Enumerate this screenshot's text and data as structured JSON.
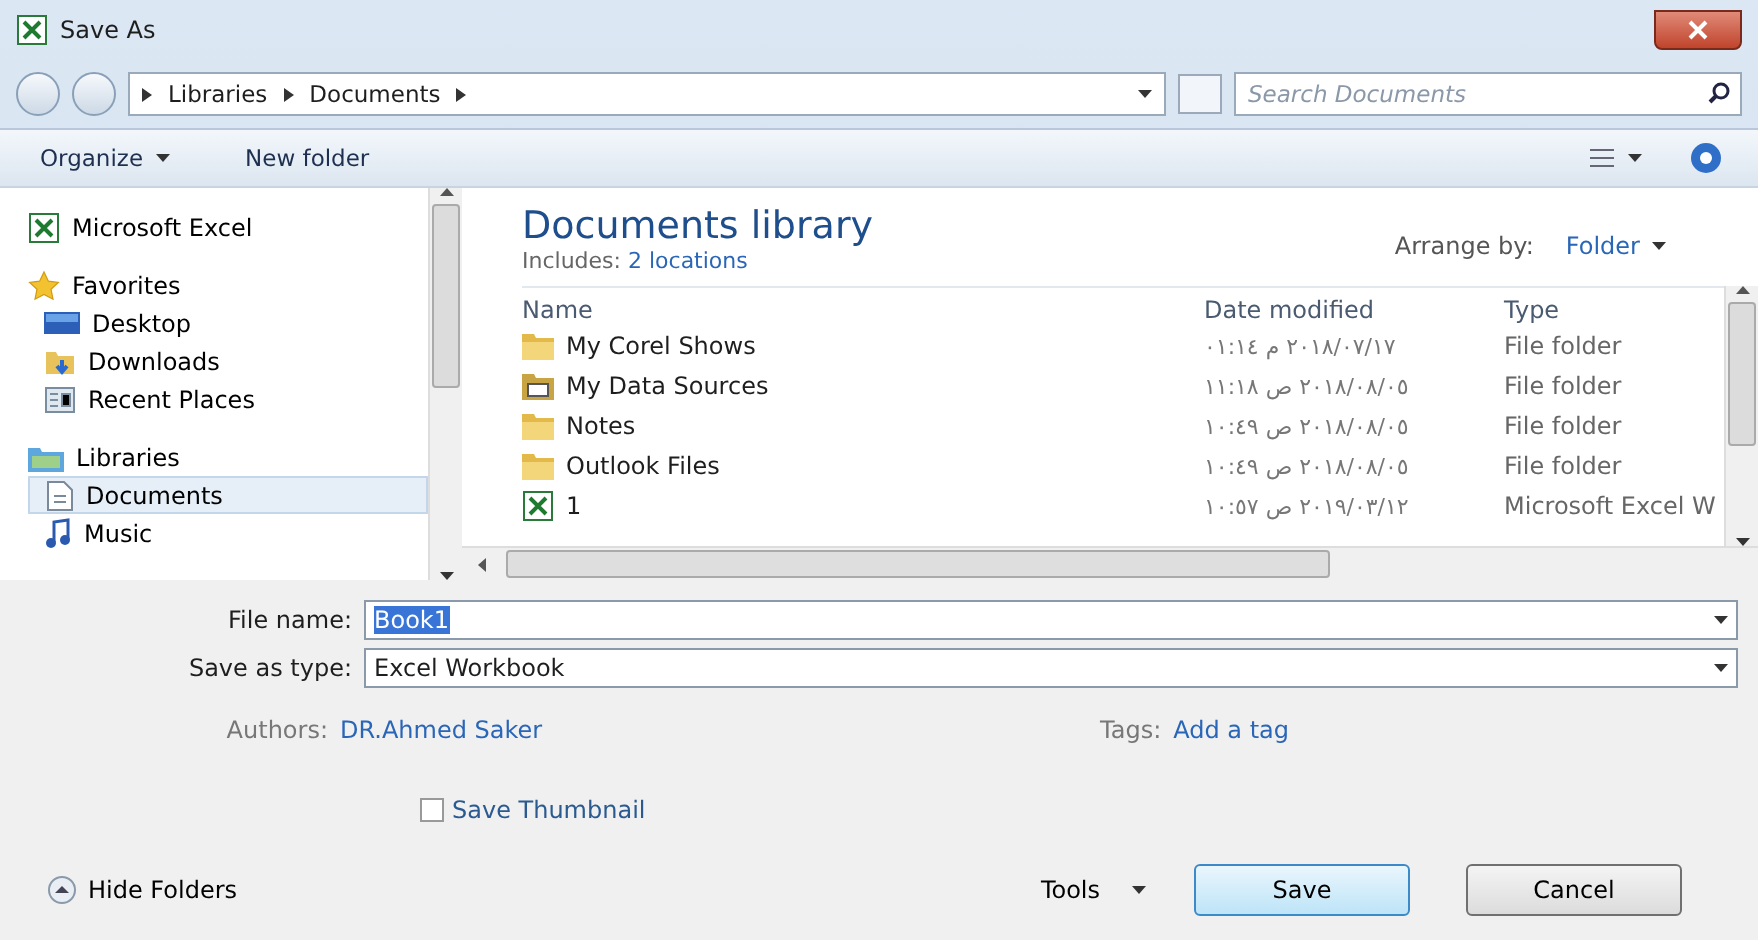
{
  "window": {
    "title": "Save As"
  },
  "address": {
    "crumbs": [
      "Libraries",
      "Documents"
    ],
    "search_placeholder": "Search Documents"
  },
  "toolbar": {
    "organize": "Organize",
    "new_folder": "New folder"
  },
  "sidebar": {
    "items": [
      {
        "label": "Microsoft Excel",
        "kind": "excel",
        "selected": false,
        "group": true
      },
      {
        "label": "Favorites",
        "kind": "star",
        "selected": false,
        "group": true
      },
      {
        "label": "Desktop",
        "kind": "desktop",
        "selected": false,
        "group": false
      },
      {
        "label": "Downloads",
        "kind": "downloads",
        "selected": false,
        "group": false
      },
      {
        "label": "Recent Places",
        "kind": "recent",
        "selected": false,
        "group": false
      },
      {
        "label": "Libraries",
        "kind": "library",
        "selected": false,
        "group": true
      },
      {
        "label": "Documents",
        "kind": "document",
        "selected": true,
        "group": false
      },
      {
        "label": "Music",
        "kind": "music",
        "selected": false,
        "group": false
      }
    ]
  },
  "library": {
    "title": "Documents library",
    "includes_label": "Includes:",
    "includes_link": "2 locations",
    "arrange_label": "Arrange by:",
    "arrange_value": "Folder"
  },
  "table": {
    "columns": [
      "Name",
      "Date modified",
      "Type"
    ],
    "rows": [
      {
        "kind": "folder",
        "name": "My Corel Shows",
        "date": "٢٠١٨/٠٧/١٧ م ٠١:١٤",
        "type": "File folder"
      },
      {
        "kind": "data",
        "name": "My Data Sources",
        "date": "٢٠١٨/٠٨/٠٥ ص ١١:١٨",
        "type": "File folder"
      },
      {
        "kind": "folder",
        "name": "Notes",
        "date": "٢٠١٨/٠٨/٠٥ ص ١٠:٤٩",
        "type": "File folder"
      },
      {
        "kind": "folder",
        "name": "Outlook Files",
        "date": "٢٠١٨/٠٨/٠٥ ص ١٠:٤٩",
        "type": "File folder"
      },
      {
        "kind": "excel",
        "name": "1",
        "date": "٢٠١٩/٠٣/١٢ ص ١٠:٥٧",
        "type": "Microsoft Excel W"
      }
    ]
  },
  "form": {
    "file_name_label": "File name:",
    "file_name": "Book1",
    "type_label": "Save as type:",
    "type_value": "Excel Workbook",
    "authors_label": "Authors:",
    "authors": "DR.Ahmed Saker",
    "tags_label": "Tags:",
    "tags_placeholder": "Add a tag",
    "thumbnail": {
      "label": "Save Thumbnail",
      "checked": false
    }
  },
  "footer": {
    "hide_folders": "Hide Folders",
    "tools": "Tools",
    "save": "Save",
    "cancel": "Cancel"
  }
}
